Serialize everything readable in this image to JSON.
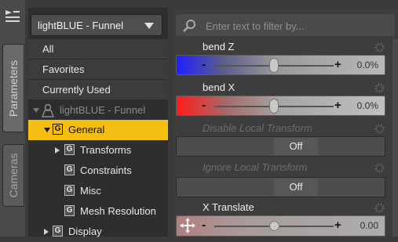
{
  "sidebar_tabs": {
    "parameters": "Parameters",
    "cameras": "Cameras"
  },
  "tree": {
    "dropdown": "lightBLUE - Funnel",
    "categories": [
      "All",
      "Favorites",
      "Currently Used"
    ],
    "node_label": "lightBLUE - Funnel",
    "items": [
      "General",
      "Transforms",
      "Constraints",
      "Misc",
      "Mesh Resolution",
      "Display"
    ],
    "group_glyph": "G",
    "selected": "General"
  },
  "filter": {
    "placeholder": "Enter text to filter by..."
  },
  "params": [
    {
      "title": "bend Z",
      "type": "slider",
      "value_text": "0.0%",
      "level": 0.5,
      "color": "blue"
    },
    {
      "title": "bend X",
      "type": "slider",
      "value_text": "0.0%",
      "level": 0.5,
      "color": "red"
    },
    {
      "title": "Disable Local Transform",
      "type": "toggle",
      "value_text": "Off",
      "enabled": false
    },
    {
      "title": "Ignore Local Transform",
      "type": "toggle",
      "value_text": "Off",
      "enabled": false
    },
    {
      "title": "X Translate",
      "type": "slider",
      "value_text": "0.00",
      "level": 0.5,
      "color": "tan"
    }
  ],
  "slider_glyphs": {
    "minus": "-",
    "plus": "+"
  },
  "colors": {
    "selection": "#f5be13",
    "bend_z_start": "#2020ff",
    "bend_x_start": "#ff1c1c",
    "panel_bg": "#2e2e2e"
  },
  "icons": [
    "panel-menu-icon",
    "figure-node-icon",
    "filter-search-icon",
    "gear-icon",
    "translate-move-icon"
  ]
}
